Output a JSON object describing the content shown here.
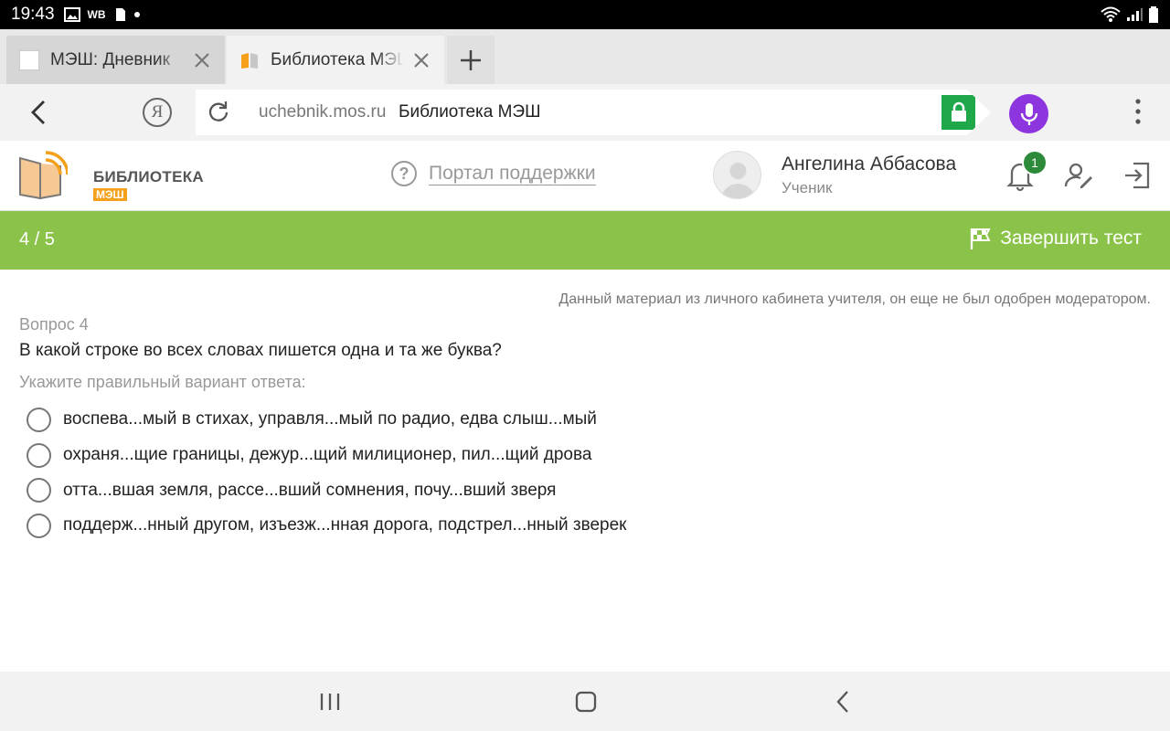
{
  "status_bar": {
    "time": "19:43",
    "notification_icons": [
      "image-icon",
      "wb-label",
      "sim-icon",
      "dot-icon"
    ],
    "wb_label": "WB"
  },
  "tabs": [
    {
      "label": "МЭШ: Дневник",
      "favicon": "blank-page-icon",
      "active": false
    },
    {
      "label": "Библиотека МЭШ",
      "favicon": "book-icon",
      "active": true
    }
  ],
  "address_bar": {
    "yandex_letter": "Я",
    "domain": "uchebnik.mos.ru",
    "page_title": "Библиотека МЭШ"
  },
  "site_header": {
    "logo_line1": "БИБЛИОТЕКА",
    "logo_line2": "МЭШ",
    "support_link": "Портал поддержки",
    "user_name": "Ангелина Аббасова",
    "user_role": "Ученик",
    "notification_count": "1"
  },
  "test_bar": {
    "progress": "4 / 5",
    "finish_label": "Завершить тест",
    "bar_color": "#8bc34a"
  },
  "question": {
    "notice": "Данный материал из личного кабинета учителя, он еще не был одобрен модератором.",
    "number_label": "Вопрос 4",
    "text": "В какой строке во всех словах пишется одна и та же буква?",
    "hint": "Укажите правильный вариант ответа:",
    "options": [
      "воспева...мый в стихах, управля...мый по радио, едва слыш...мый",
      "охраня...щие границы, дежур...щий милиционер, пил...щий дрова",
      "отта...вшая земля, рассе...вший сомнения, почу...вший зверя",
      "поддерж...нный другом, изъезж...нная дорога, подстрел...нный зверек"
    ]
  },
  "colors": {
    "lock_green": "#1fa84a",
    "mic_purple": "#8d36e0",
    "badge_green": "#2d8a3a",
    "logo_orange": "#f4a01b"
  }
}
